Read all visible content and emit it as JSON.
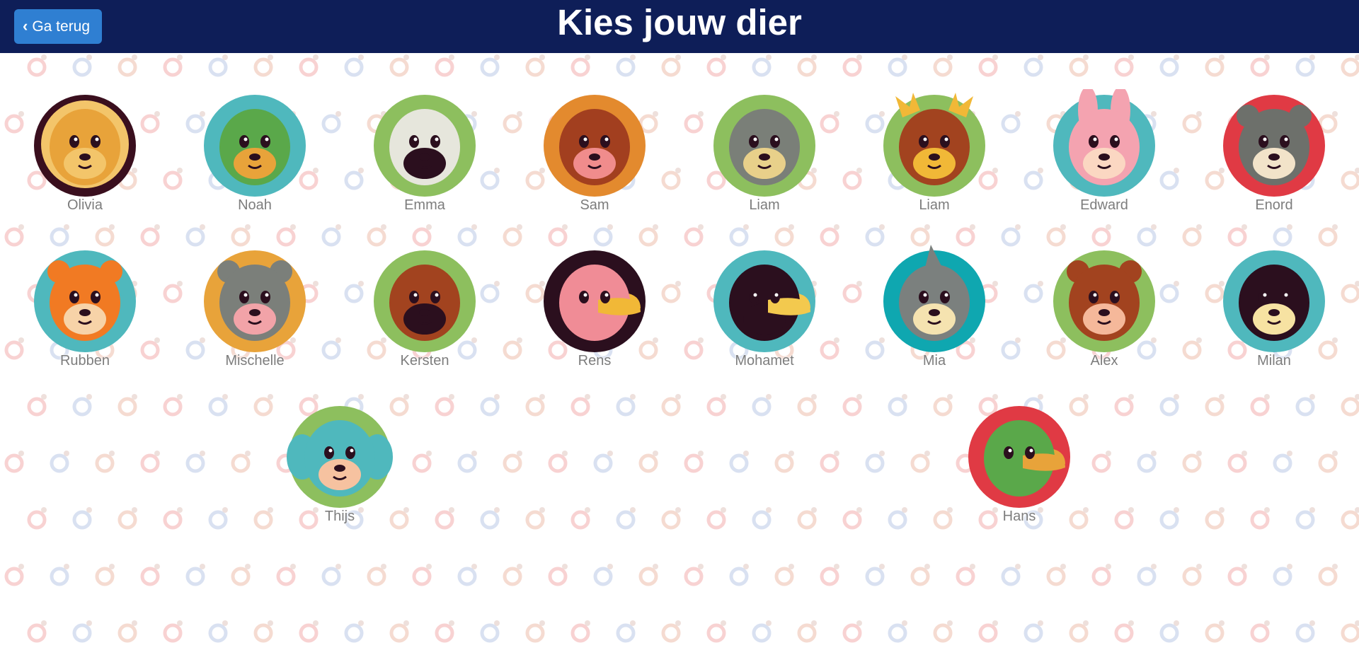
{
  "header": {
    "back_label": "Ga terug",
    "title": "Kies jouw dier"
  },
  "colors": {
    "header_bg": "#0e1e58",
    "button_bg": "#2f7fd2",
    "name_text": "#7d7d7d"
  },
  "animals": [
    {
      "name": "Olivia",
      "animal": "lion-icon",
      "bg": "#3a0f1e",
      "main": "#e8a33a",
      "accent": "#f3c56a"
    },
    {
      "name": "Noah",
      "animal": "crocodile-icon",
      "bg": "#4fb8bd",
      "main": "#5aa84a",
      "accent": "#e8a33a"
    },
    {
      "name": "Emma",
      "animal": "zebra-icon",
      "bg": "#8dbf5e",
      "main": "#e6e6dc",
      "accent": "#2b0f1e"
    },
    {
      "name": "Sam",
      "animal": "boar-icon",
      "bg": "#e38a2e",
      "main": "#a23f1f",
      "accent": "#f08c8c"
    },
    {
      "name": "Liam",
      "animal": "rhino-icon",
      "bg": "#8dbf5e",
      "main": "#7a7f78",
      "accent": "#e8d08a"
    },
    {
      "name": "Liam",
      "animal": "moose-icon",
      "bg": "#8dbf5e",
      "main": "#a2431f",
      "accent": "#f1b837"
    },
    {
      "name": "Edward",
      "animal": "rabbit-icon",
      "bg": "#4fb8bd",
      "main": "#f4a3b0",
      "accent": "#fbd7c2"
    },
    {
      "name": "Enord",
      "animal": "raccoon-icon",
      "bg": "#e03a44",
      "main": "#6d706b",
      "accent": "#f2e3c9"
    },
    {
      "name": "Rubben",
      "animal": "tiger-icon",
      "bg": "#4fb8bd",
      "main": "#f17a23",
      "accent": "#f7d3a8"
    },
    {
      "name": "Mischelle",
      "animal": "koala-icon",
      "bg": "#e8a33a",
      "main": "#7b7f7a",
      "accent": "#f2a3a8"
    },
    {
      "name": "Kersten",
      "animal": "horse-icon",
      "bg": "#8dbf5e",
      "main": "#a2431f",
      "accent": "#2b0f1e"
    },
    {
      "name": "Rens",
      "animal": "flamingo-icon",
      "bg": "#2b0f1e",
      "main": "#f08c96",
      "accent": "#f1b837"
    },
    {
      "name": "Mohamet",
      "animal": "toucan-icon",
      "bg": "#4fb8bd",
      "main": "#2b0f1e",
      "accent": "#f3c94e"
    },
    {
      "name": "Mia",
      "animal": "shark-icon",
      "bg": "#0fa7b0",
      "main": "#7b807e",
      "accent": "#f5e3b0"
    },
    {
      "name": "Alex",
      "animal": "bear-icon",
      "bg": "#8dbf5e",
      "main": "#a2431f",
      "accent": "#f5b89a"
    },
    {
      "name": "Milan",
      "animal": "penguin-icon",
      "bg": "#4fb8bd",
      "main": "#2b0f1e",
      "accent": "#f7e2a2"
    },
    {
      "name": "Thijs",
      "animal": "elephant-icon",
      "bg": "#8dbf5e",
      "main": "#4fb8bd",
      "accent": "#f6c2a0"
    },
    {
      "name": "Hans",
      "animal": "duck-icon",
      "bg": "#e03a44",
      "main": "#5aa84a",
      "accent": "#e8a33a"
    }
  ]
}
